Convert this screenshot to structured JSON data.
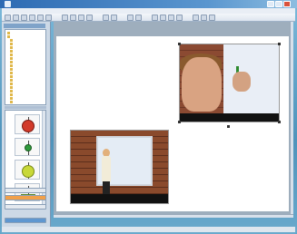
{
  "window": {
    "title": "",
    "colors": {
      "titlebar": "#2e6bb3",
      "accent": "#5fa6c9"
    }
  },
  "menu": [],
  "toolbar": {
    "icons": [
      "select-tool-icon",
      "pen-tool-icon",
      "highlighter-icon",
      "eraser-icon",
      "line-tool-icon",
      "shape-tool-icon",
      "text-tool-icon",
      "fill-icon",
      "undo-icon",
      "redo-icon",
      "delete-icon",
      "zoom-icon",
      "screen-shade-icon",
      "capture-icon",
      "properties-icon"
    ]
  },
  "sidebar": {
    "header": "",
    "tree_items": [
      "",
      "",
      "",
      "",
      "",
      "",
      "",
      "",
      "",
      "",
      "",
      "",
      "",
      "",
      "",
      "",
      "",
      "",
      "",
      ""
    ],
    "gallery_items": [
      "traffic-light-red",
      "traffic-light-green",
      "traffic-light-yellow",
      "traffic-light-flag"
    ],
    "buttons": [
      {
        "label": "",
        "style": "gray"
      },
      {
        "label": "",
        "style": "orange"
      },
      {
        "label": "",
        "style": "gray"
      },
      {
        "label": "",
        "style": "blue"
      }
    ]
  },
  "canvas": {
    "images": [
      {
        "subject": "person-writing-on-whiteboard-closeup"
      },
      {
        "subject": "person-presenting-at-interactive-whiteboard"
      }
    ]
  }
}
